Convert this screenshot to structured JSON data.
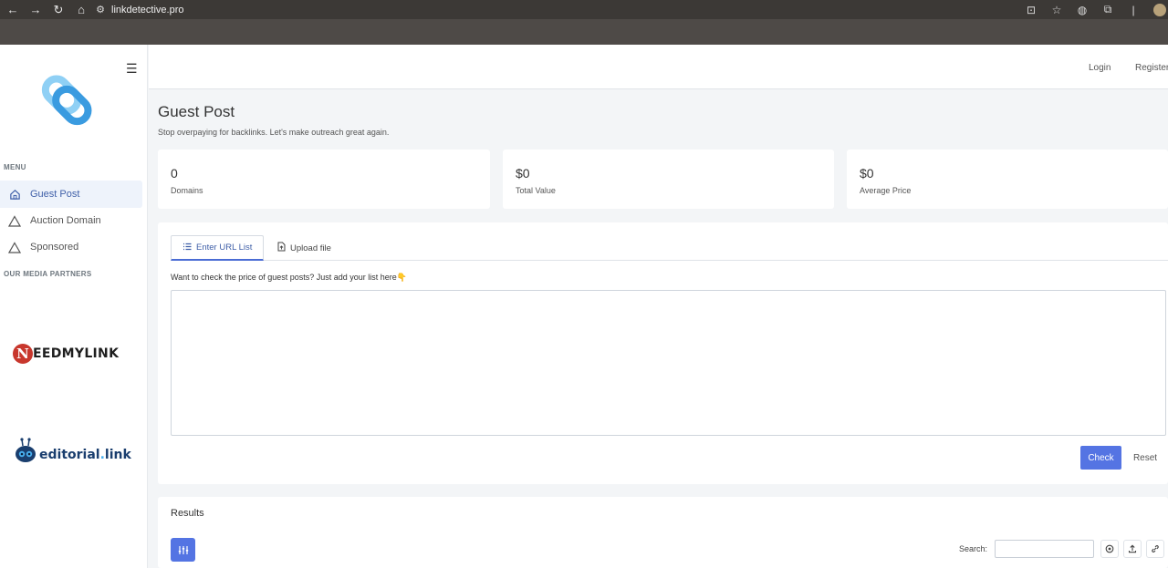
{
  "browser": {
    "url": "linkdetective.pro"
  },
  "sidebar": {
    "menu_heading": "MENU",
    "items": [
      {
        "label": "Guest Post",
        "icon": "home-icon",
        "active": true
      },
      {
        "label": "Auction Domain",
        "icon": "triangle-icon",
        "active": false
      },
      {
        "label": "Sponsored",
        "icon": "triangle-icon",
        "active": false
      }
    ],
    "partners_heading": "OUR MEDIA PARTNERS",
    "partners": [
      {
        "name": "NEEDMYLINK",
        "mark": "N",
        "rest": "EEDMYLINK"
      },
      {
        "name": "editorial.link",
        "prefix": "editorial",
        "dot": ".",
        "suffix": "link"
      }
    ]
  },
  "header": {
    "login": "Login",
    "register": "Register"
  },
  "page": {
    "title": "Guest Post",
    "subtitle": "Stop overpaying for backlinks. Let's make outreach great again."
  },
  "stats": [
    {
      "value": "0",
      "label": "Domains"
    },
    {
      "value": "$0",
      "label": "Total Value"
    },
    {
      "value": "$0",
      "label": "Average Price"
    }
  ],
  "checker": {
    "tabs": [
      {
        "label": "Enter URL List",
        "icon": "list-icon",
        "active": true
      },
      {
        "label": "Upload file",
        "icon": "file-upload-icon",
        "active": false
      }
    ],
    "prompt": "Want to check the price of guest posts? Just add your list here👇",
    "textarea_value": "",
    "check_label": "Check",
    "reset_label": "Reset"
  },
  "results": {
    "title": "Results",
    "search_label": "Search:",
    "search_value": ""
  },
  "colors": {
    "accent": "#5474e3",
    "active_bg": "#eef3fb",
    "logo_light": "#8fd0f5",
    "logo_dark": "#3a9be0",
    "nml_red": "#c8372d"
  }
}
